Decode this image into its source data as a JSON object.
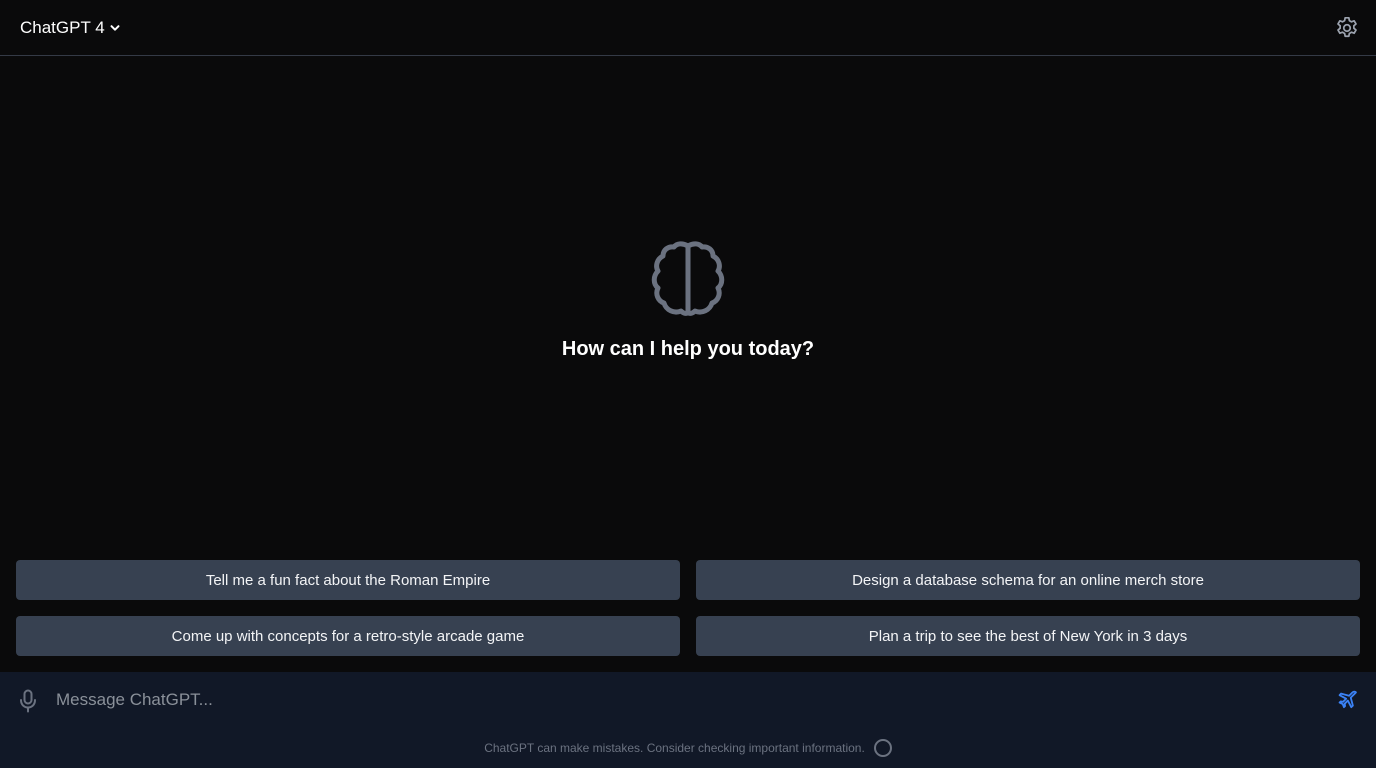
{
  "header": {
    "model_label": "ChatGPT 4",
    "model_chevron_icon": "chevron-down-icon",
    "settings_icon": "gear-icon"
  },
  "hero": {
    "icon": "brain-icon",
    "title": "How can I help you today?"
  },
  "suggestions": [
    {
      "label": "Tell me a fun fact about the Roman Empire"
    },
    {
      "label": "Design a database schema for an online merch store"
    },
    {
      "label": "Come up with concepts for a retro-style arcade game"
    },
    {
      "label": "Plan a trip to see the best of New York in 3 days"
    }
  ],
  "composer": {
    "mic_icon": "microphone-icon",
    "placeholder": "Message ChatGPT...",
    "value": "",
    "send_icon": "paper-plane-icon",
    "disclaimer": "ChatGPT can make mistakes. Consider checking important information.",
    "status_icon": "circle-icon"
  },
  "colors": {
    "background": "#0a0a0b",
    "suggestion_bg": "#374151",
    "composer_bg": "#111827",
    "accent": "#3b82f6",
    "icon_muted": "#6b7280"
  }
}
